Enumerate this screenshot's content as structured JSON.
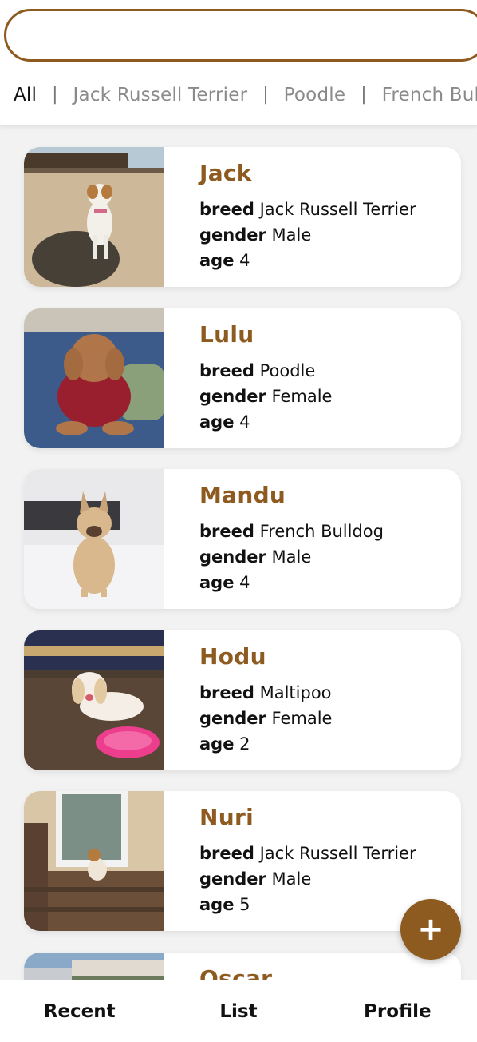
{
  "search": {
    "placeholder": "",
    "value": ""
  },
  "filters": {
    "items": [
      "All",
      "Jack Russell Terrier",
      "Poodle",
      "French Bulldog"
    ],
    "active": "All",
    "separator": "|"
  },
  "labels": {
    "breed": "breed",
    "gender": "gender",
    "age": "age"
  },
  "dogs": [
    {
      "name": "Jack",
      "breed": "Jack Russell Terrier",
      "gender": "Male",
      "age": "4",
      "photo": "dog-photo-jack"
    },
    {
      "name": "Lulu",
      "breed": "Poodle",
      "gender": "Female",
      "age": "4",
      "photo": "dog-photo-lulu"
    },
    {
      "name": "Mandu",
      "breed": "French Bulldog",
      "gender": "Male",
      "age": "4",
      "photo": "dog-photo-mandu"
    },
    {
      "name": "Hodu",
      "breed": "Maltipoo",
      "gender": "Female",
      "age": "2",
      "photo": "dog-photo-hodu"
    },
    {
      "name": "Nuri",
      "breed": "Jack Russell Terrier",
      "gender": "Male",
      "age": "5",
      "photo": "dog-photo-nuri"
    },
    {
      "name": "Oscar",
      "breed": "",
      "gender": "",
      "age": "",
      "photo": "dog-photo-oscar"
    }
  ],
  "fab": {
    "label": "+",
    "icon": "plus-icon"
  },
  "nav": {
    "items": [
      "Recent",
      "List",
      "Profile"
    ]
  },
  "colors": {
    "accent": "#8d5a1f",
    "background": "#f2f2f2",
    "card": "#ffffff"
  }
}
